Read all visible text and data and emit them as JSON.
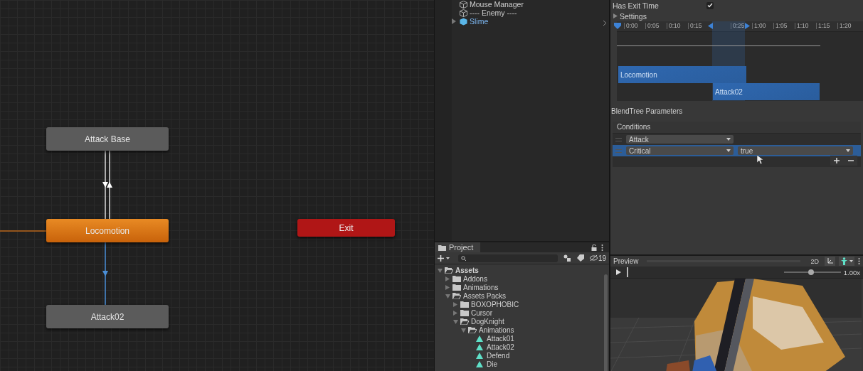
{
  "graph": {
    "nodes": [
      {
        "label": "Attack Base",
        "kind": "state",
        "selected": false
      },
      {
        "label": "Locomotion",
        "kind": "default",
        "selected": false
      },
      {
        "label": "Attack02",
        "kind": "state",
        "selected": false
      },
      {
        "label": "Exit",
        "kind": "exit",
        "selected": false
      }
    ]
  },
  "hierarchy": {
    "items": [
      {
        "label": "Mouse Manager",
        "kind": "object"
      },
      {
        "label": "---- Enemy ----",
        "kind": "object"
      },
      {
        "label": "Slime",
        "kind": "prefab",
        "expanded": false
      }
    ]
  },
  "project": {
    "tab": "Project",
    "hidden_count": "19",
    "tree": [
      {
        "label": "Assets",
        "kind": "folder",
        "expanded": true,
        "children": [
          {
            "label": "Addons",
            "kind": "folder",
            "expanded": false
          },
          {
            "label": "Animations",
            "kind": "folder",
            "expanded": false
          },
          {
            "label": "Assets Packs",
            "kind": "folder",
            "expanded": true,
            "children": [
              {
                "label": "BOXOPHOBIC",
                "kind": "folder",
                "expanded": false
              },
              {
                "label": "Cursor",
                "kind": "folder",
                "expanded": false
              },
              {
                "label": "DogKnight",
                "kind": "folder",
                "expanded": true,
                "children": [
                  {
                    "label": "Animations",
                    "kind": "folder",
                    "expanded": true,
                    "children": [
                      {
                        "label": "Attack01",
                        "kind": "clip"
                      },
                      {
                        "label": "Attack02",
                        "kind": "clip"
                      },
                      {
                        "label": "Defend",
                        "kind": "clip"
                      },
                      {
                        "label": "Die",
                        "kind": "clip"
                      }
                    ]
                  }
                ]
              }
            ]
          }
        ]
      }
    ]
  },
  "inspector": {
    "has_exit_time": {
      "label": "Has Exit Time",
      "checked": true
    },
    "settings": {
      "label": "Settings",
      "expanded": false
    },
    "timeline": {
      "ticks": [
        "0:00",
        "0:05",
        "0:10",
        "0:15",
        "0:25",
        "1:00",
        "1:05",
        "1:10",
        "1:15",
        "1:20"
      ],
      "clips": [
        {
          "label": "Locomotion"
        },
        {
          "label": "Attack02"
        }
      ]
    },
    "blendtree_label": "BlendTree Parameters",
    "conditions": {
      "title": "Conditions",
      "rows": [
        {
          "parameter": "Attack",
          "selected": false
        },
        {
          "parameter": "Critical",
          "value": "true",
          "selected": true
        }
      ]
    }
  },
  "preview": {
    "title": "Preview",
    "mode": "2D",
    "speed": "1.00x",
    "level": 0.48
  }
}
